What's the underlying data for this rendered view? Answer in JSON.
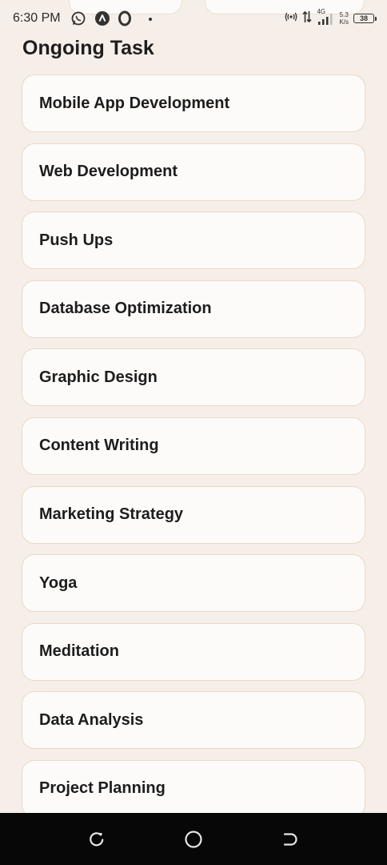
{
  "status_bar": {
    "time": "6:30 PM",
    "network_type": "4G",
    "net_speed_value": "5.3",
    "net_speed_unit": "K/s",
    "battery_level": "38"
  },
  "page": {
    "title": "Ongoing Task"
  },
  "tasks": [
    {
      "label": "Mobile App Development"
    },
    {
      "label": "Web Development"
    },
    {
      "label": "Push Ups"
    },
    {
      "label": "Database Optimization"
    },
    {
      "label": "Graphic Design"
    },
    {
      "label": "Content Writing"
    },
    {
      "label": "Marketing Strategy"
    },
    {
      "label": "Yoga"
    },
    {
      "label": "Meditation"
    },
    {
      "label": "Data Analysis"
    },
    {
      "label": "Project Planning"
    }
  ],
  "navigation": {
    "recent_icon": "recent-apps-icon",
    "home_icon": "home-circle-icon",
    "back_icon": "back-icon"
  },
  "colors": {
    "background": "#f6efe9",
    "card_background": "#fcfbfa",
    "card_border": "#ead9c3",
    "text": "#1d1d1d",
    "nav_bar": "#070707"
  }
}
